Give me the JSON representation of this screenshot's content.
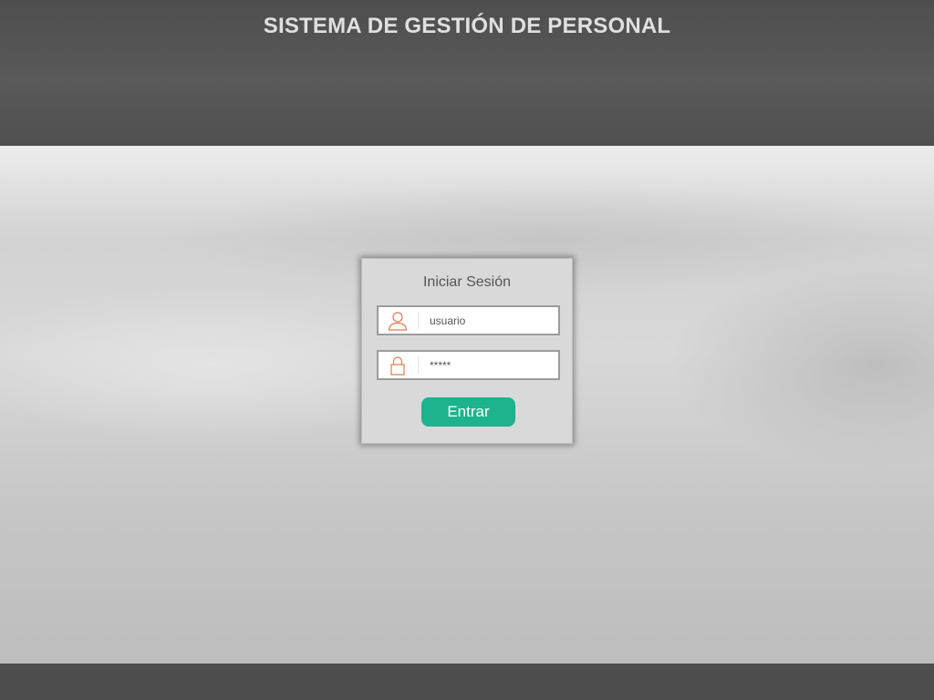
{
  "header": {
    "title": "SISTEMA DE GESTIÓN DE PERSONAL"
  },
  "login": {
    "title": "Iniciar Sesión",
    "username": {
      "value": "usuario",
      "icon": "user-icon"
    },
    "password": {
      "value": "*****",
      "icon": "lock-icon"
    },
    "submit_label": "Entrar"
  },
  "colors": {
    "header_bg": "#565656",
    "footer_bg": "#4d4d4d",
    "accent": "#1db38c",
    "icon": "#e07a4f"
  }
}
